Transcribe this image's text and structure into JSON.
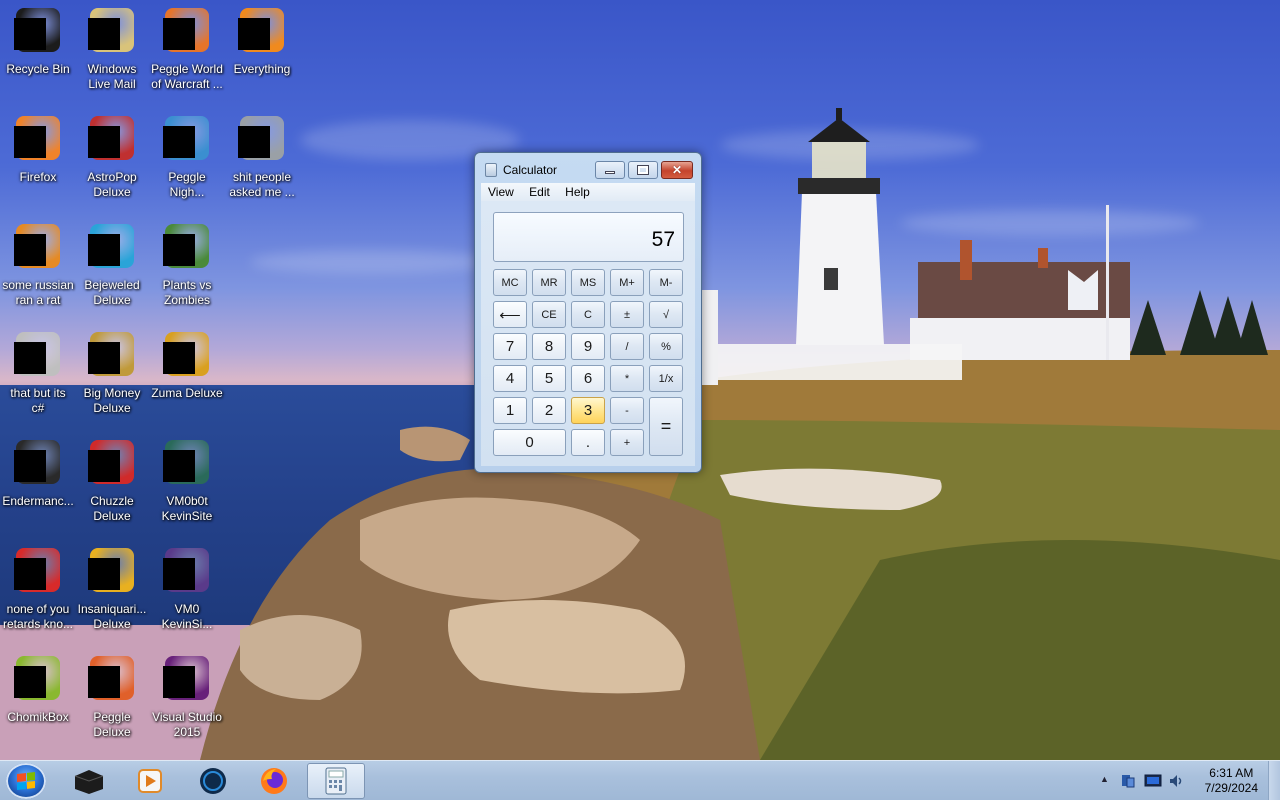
{
  "desktop": {
    "icons": [
      {
        "label": "Recycle Bin",
        "icon": "recycle-bin-icon",
        "color": "#1c1c1c"
      },
      {
        "label": "Windows\nLive Mail",
        "icon": "mail-icon",
        "color": "#d9c37a"
      },
      {
        "label": "Peggle World\nof Warcraft ...",
        "icon": "peggle-icon",
        "color": "#e6742a"
      },
      {
        "label": "Everything",
        "icon": "search-icon",
        "color": "#f08a1e"
      },
      {
        "label": "Firefox",
        "icon": "firefox-icon",
        "color": "#f0832a"
      },
      {
        "label": "AstroPop\nDeluxe",
        "icon": "astropop-icon",
        "color": "#c03030"
      },
      {
        "label": "Peggle\nNigh...",
        "icon": "peggle-nights-icon",
        "color": "#3b8fd0"
      },
      {
        "label": "shit people\nasked me ...",
        "icon": "folder-icon",
        "color": "#9aa0a6"
      },
      {
        "label": "some russian\nran a rat",
        "icon": "java-icon",
        "color": "#e58a24"
      },
      {
        "label": "Bejeweled\nDeluxe",
        "icon": "bejeweled-icon",
        "color": "#2aa4d8"
      },
      {
        "label": "Plants vs\nZombies",
        "icon": "plants-icon",
        "color": "#4a8a3a"
      },
      {
        "label": "that but its\nc#",
        "icon": "shortcut-icon",
        "color": "#bfbfbf"
      },
      {
        "label": "Big Money\nDeluxe",
        "icon": "money-icon",
        "color": "#c09a3a"
      },
      {
        "label": "Zuma Deluxe",
        "icon": "zuma-icon",
        "color": "#d9a020"
      },
      {
        "label": "Endermanc...",
        "icon": "console-icon",
        "color": "#2a2a2a"
      },
      {
        "label": "Chuzzle\nDeluxe",
        "icon": "chuzzle-icon",
        "color": "#d02a2a"
      },
      {
        "label": "VM0b0t\nKevinSite",
        "icon": "vm-icon",
        "color": "#2a6a5a"
      },
      {
        "label": "none of you\nretards kno...",
        "icon": "opera-icon",
        "color": "#d82a2a"
      },
      {
        "label": "Insaniquari...\nDeluxe",
        "icon": "fish-icon",
        "color": "#e8b020"
      },
      {
        "label": "VM0\nKevinSi...",
        "icon": "vm2-icon",
        "color": "#5a3a8a"
      },
      {
        "label": "ChomikBox",
        "icon": "chomikbox-icon",
        "color": "#8ab830"
      },
      {
        "label": "Peggle\nDeluxe",
        "icon": "peggle-deluxe-icon",
        "color": "#e0602a"
      },
      {
        "label": "Visual Studio\n2015",
        "icon": "visual-studio-icon",
        "color": "#68217a"
      }
    ]
  },
  "calculator": {
    "title": "Calculator",
    "menu": [
      "View",
      "Edit",
      "Help"
    ],
    "display": "57",
    "keys": {
      "mc": "MC",
      "mr": "MR",
      "ms": "MS",
      "mplus": "M+",
      "mminus": "M-",
      "back": "⟵",
      "ce": "CE",
      "c": "C",
      "plusminus": "±",
      "sqrt": "√",
      "k7": "7",
      "k8": "8",
      "k9": "9",
      "div": "/",
      "pct": "%",
      "k4": "4",
      "k5": "5",
      "k6": "6",
      "mul": "*",
      "recip": "1/x",
      "k1": "1",
      "k2": "2",
      "k3": "3",
      "sub": "-",
      "eq": "=",
      "k0": "0",
      "dot": ".",
      "add": "+"
    }
  },
  "taskbar": {
    "apps": [
      "Mystery Box",
      "Media Player",
      "Web Browser",
      "Firefox",
      "Calculator"
    ],
    "time": "6:31 AM",
    "date": "7/29/2024",
    "tray_arrow": "▲"
  }
}
